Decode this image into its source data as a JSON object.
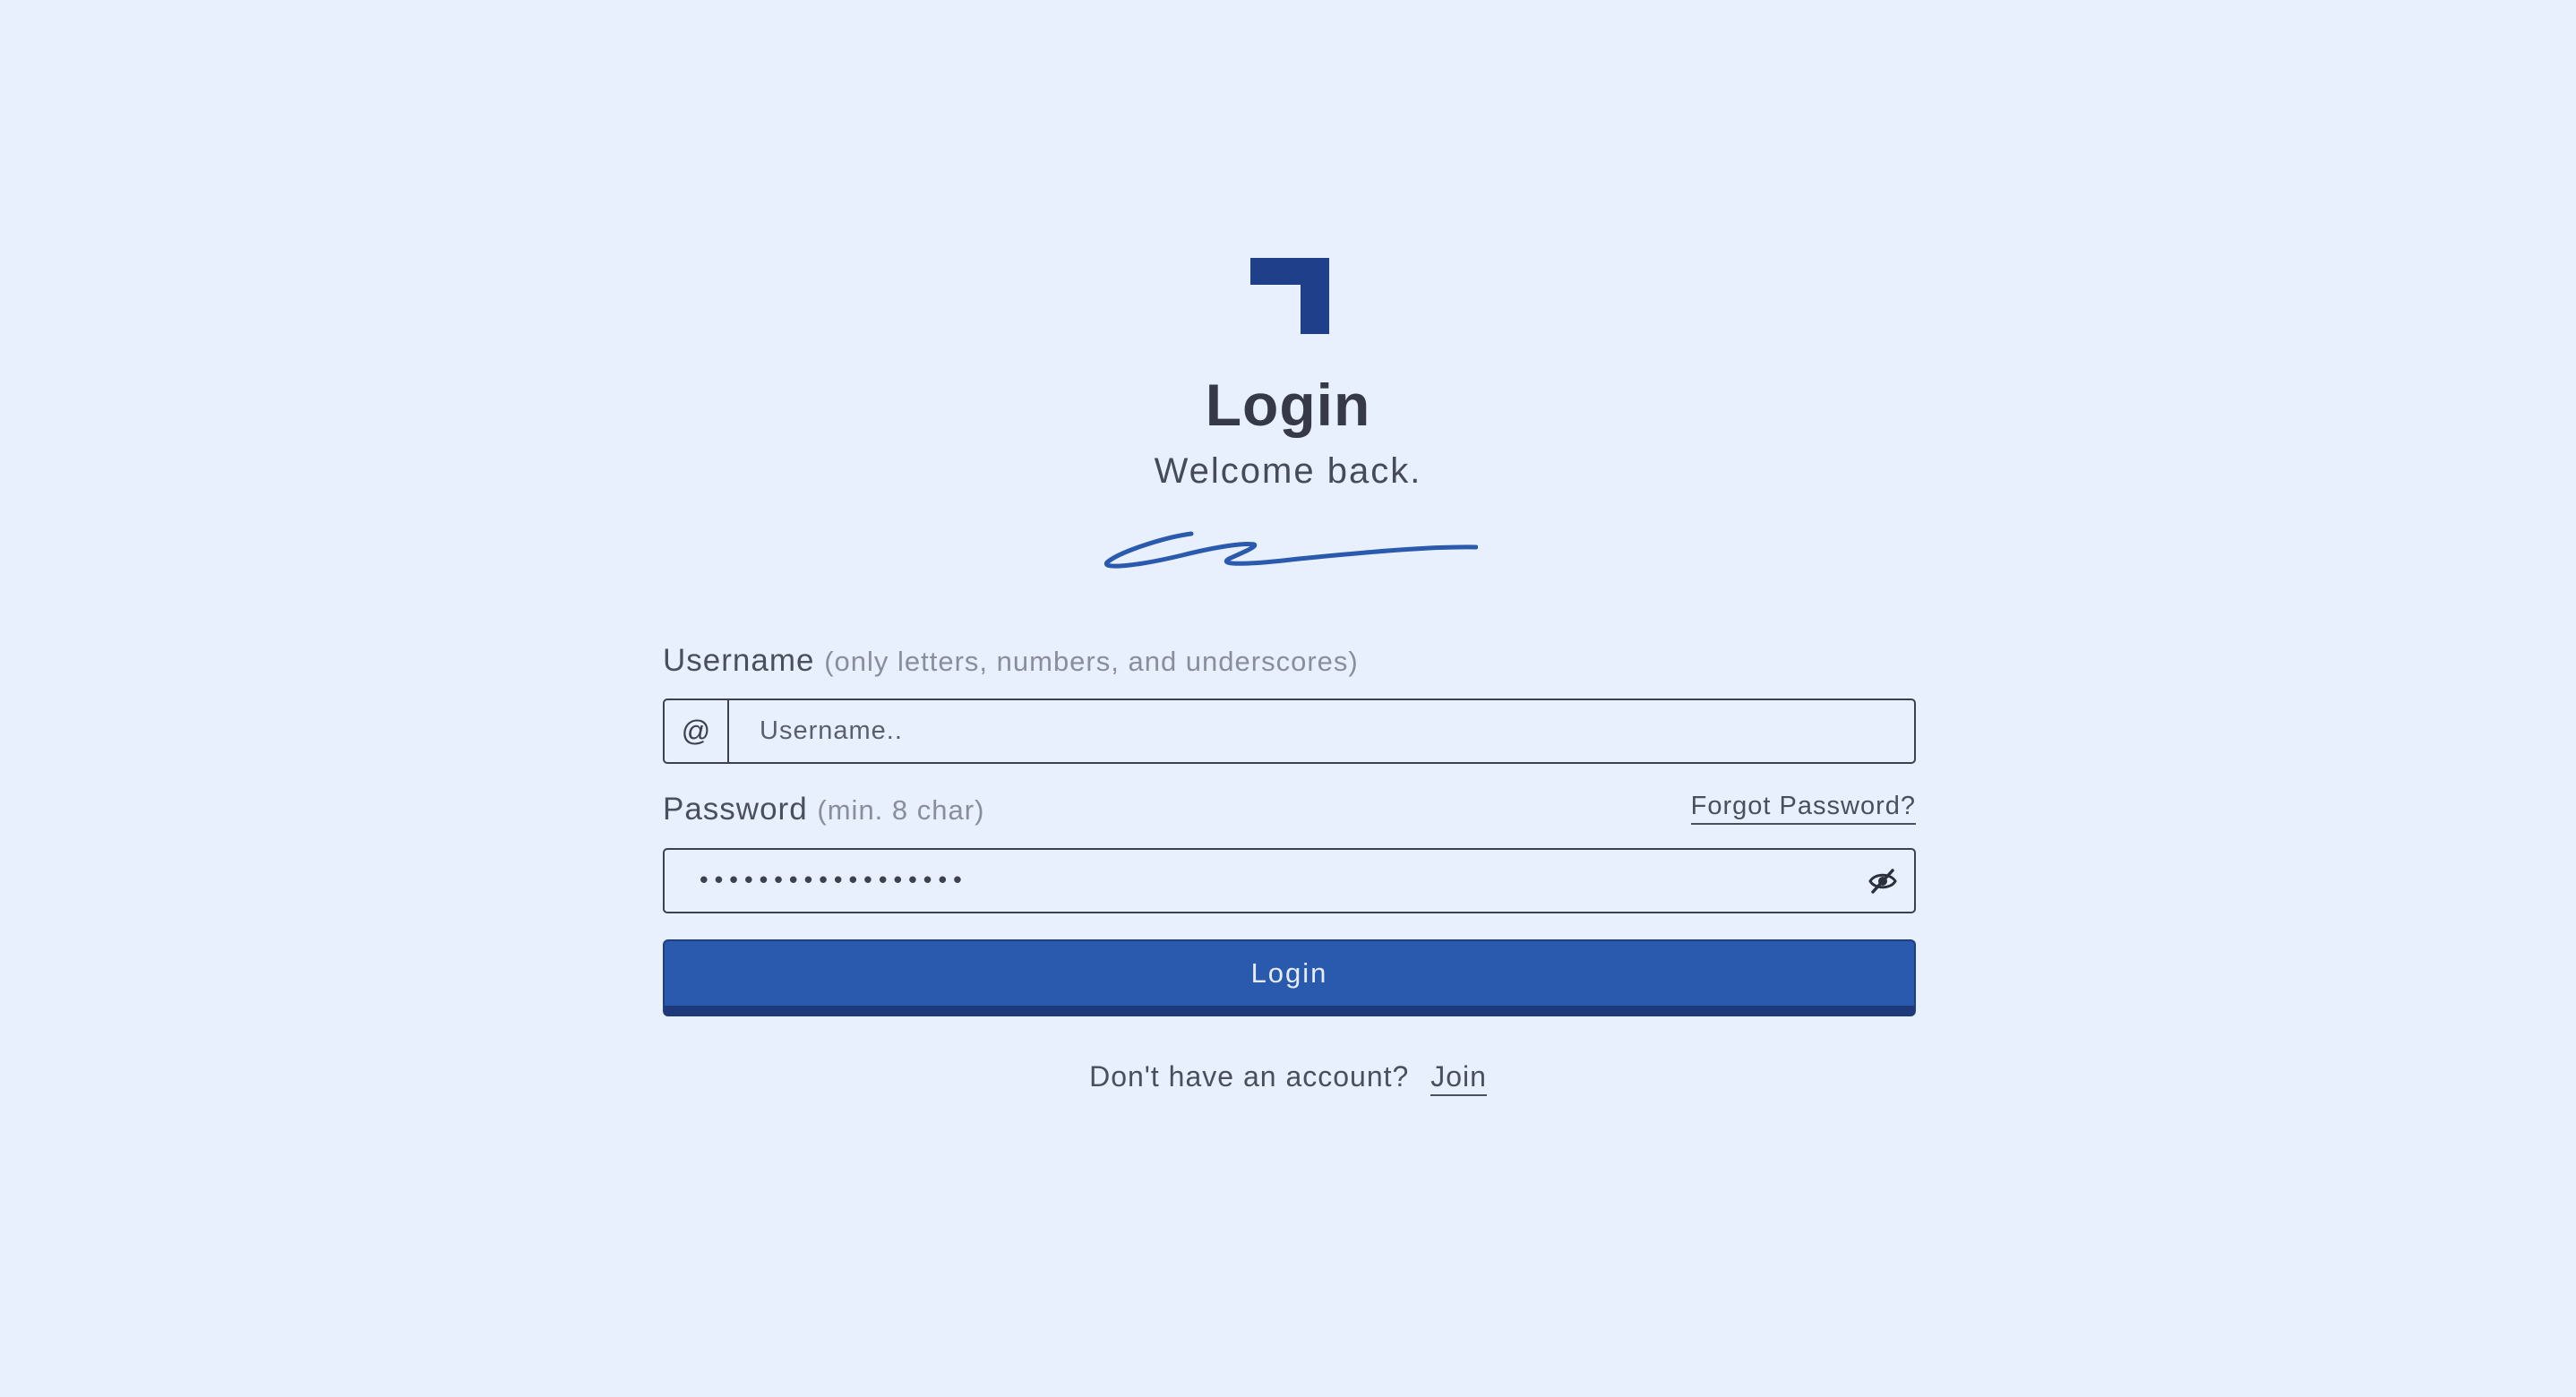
{
  "header": {
    "logo_icon": "corner-bracket-logo",
    "title": "Login",
    "subtitle": "Welcome back.",
    "decoration": "signature-squiggle"
  },
  "form": {
    "username": {
      "label": "Username",
      "hint": "(only letters, numbers, and underscores)",
      "prefix": "@",
      "placeholder": "Username..",
      "value": ""
    },
    "password": {
      "label": "Password",
      "hint": "(min. 8 char)",
      "forgot_link": "Forgot Password?",
      "value": "••••••••••••••••••",
      "toggle_icon": "eye-slash-icon"
    },
    "submit_label": "Login"
  },
  "footer": {
    "prompt": "Don't have an account?",
    "join_link": "Join"
  },
  "colors": {
    "background": "#e8effd",
    "primary": "#2a5aad",
    "primary_dark": "#1e3a7a",
    "logo": "#1f3f8a",
    "text": "#353948"
  }
}
